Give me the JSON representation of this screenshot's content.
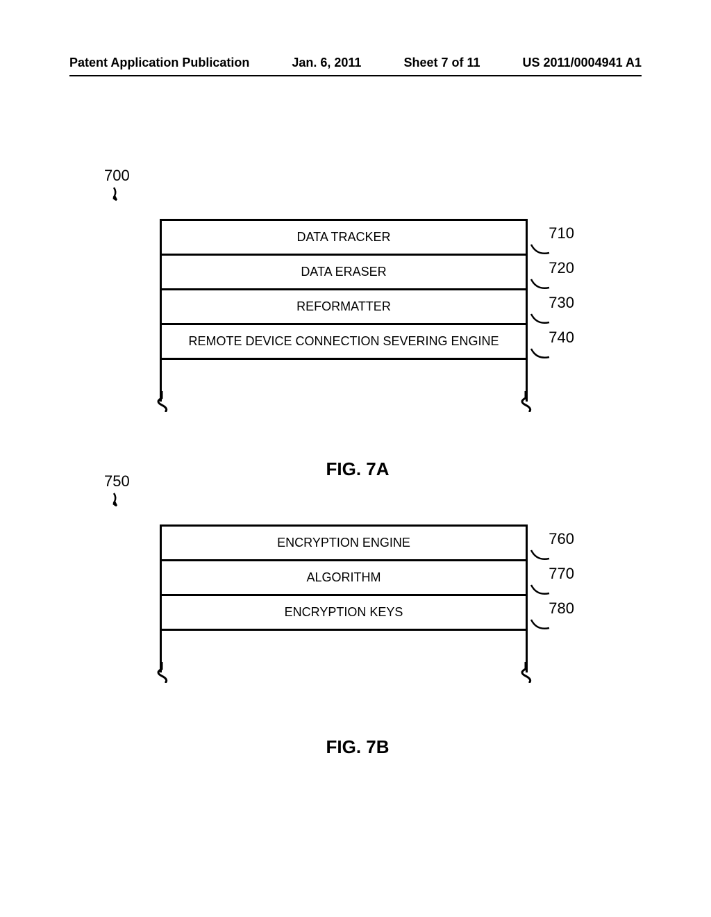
{
  "header": {
    "publication_type": "Patent Application Publication",
    "date": "Jan. 6, 2011",
    "sheet": "Sheet 7 of 11",
    "patent_number": "US 2011/0004941 A1"
  },
  "figure_7a": {
    "ref_number": "700",
    "rows": [
      {
        "label": "DATA TRACKER",
        "ref": "710"
      },
      {
        "label": "DATA ERASER",
        "ref": "720"
      },
      {
        "label": "REFORMATTER",
        "ref": "730"
      },
      {
        "label": "REMOTE DEVICE CONNECTION SEVERING ENGINE",
        "ref": "740"
      }
    ],
    "caption": "FIG. 7A"
  },
  "figure_7b": {
    "ref_number": "750",
    "rows": [
      {
        "label": "ENCRYPTION ENGINE",
        "ref": "760"
      },
      {
        "label": "ALGORITHM",
        "ref": "770"
      },
      {
        "label": "ENCRYPTION KEYS",
        "ref": "780"
      }
    ],
    "caption": "FIG. 7B"
  }
}
